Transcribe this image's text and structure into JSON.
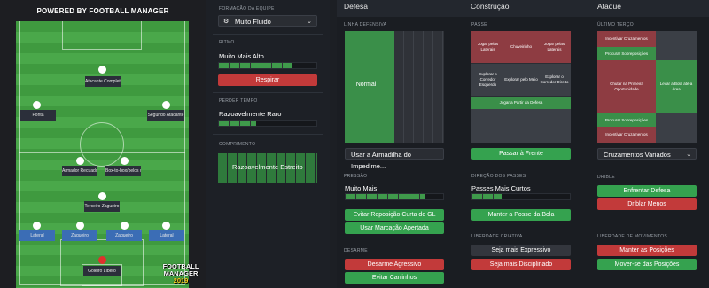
{
  "pitch": {
    "title": "POWERED BY FOOTBALL MANAGER",
    "players": [
      "Atacante Completo",
      "Ponta",
      "Segundo Atacante",
      "Armador Recuado",
      "Box-to-box/pelos c...",
      "Terceiro Zagueiro",
      "Lateral",
      "Zagueiro",
      "Zagueiro",
      "Lateral",
      "Goleiro Líbero"
    ],
    "logo": [
      "FOOTBALL",
      "MANAGER",
      "2019"
    ]
  },
  "sidebar": {
    "formation_label": "FORMAÇÃO DA EQUIPE",
    "formation_value": "Muito Fluido",
    "tempo_label": "RITMO",
    "tempo_value": "Muito Mais Alto",
    "tempo_button": "Respirar",
    "time_wasting_label": "PERDER TEMPO",
    "time_wasting_value": "Razoavelmente Raro",
    "width_label": "COMPRIMENTO",
    "width_value": "Razoavelmente Estreito"
  },
  "defesa": {
    "title": "Defesa",
    "line_label": "LINHA DEFENSIVA",
    "line_value": "Normal",
    "offside_select": "Usar a Armadilha do Impedime...",
    "press_label": "PRESSÃO",
    "press_value": "Muito Mais",
    "btn1": "Evitar Reposição Curta do GL",
    "btn2": "Usar Marcação Apertada",
    "tackle_label": "DESARME",
    "btn3": "Desarme Agressivo",
    "btn4": "Evitar Carrinhos"
  },
  "construcao": {
    "title": "Construção",
    "pass_label": "PASSE",
    "cells": [
      "Jogar pelas Laterais",
      "Chuveirinho",
      "Jogar pelas Laterais",
      "Explorar o Corredor Esquerdo",
      "Explorar pelo Meio",
      "Explorar o Corredor Direito",
      "Jogar a Partir da Defesa"
    ],
    "forward_btn": "Passar à Frente",
    "dir_label": "DIREÇÃO DOS PASSES",
    "dir_value": "Passes Mais Curtos",
    "possession_btn": "Manter a Posse da Bola",
    "creative_label": "LIBERDADE CRIATIVA",
    "btn_expressive": "Seja mais Expressivo",
    "btn_disciplined": "Seja mais Disciplinado"
  },
  "ataque": {
    "title": "Ataque",
    "third_label": "ÚLTIMO TERÇO",
    "cells": [
      "Incentivar Cruzamentos",
      "Procurar Sobreposições",
      "Chutar na Primeira Oportunidade",
      "Levar a Bola até a Área",
      "Procurar Sobreposições",
      "Incentivar Cruzamentos"
    ],
    "cross_select": "Cruzamentos Variados",
    "dribble_label": "DRIBLE",
    "btn_defense": "Enfrentar Defesa",
    "btn_dribble": "Driblar Menos",
    "movement_label": "LIBERDADE DE MOVIMENTOS",
    "btn_positions": "Manter as Posições",
    "btn_move": "Mover-se das Posições"
  },
  "colors": {
    "red": "#c23a3a",
    "green": "#35a24f",
    "pitch": "#4aa84a"
  }
}
